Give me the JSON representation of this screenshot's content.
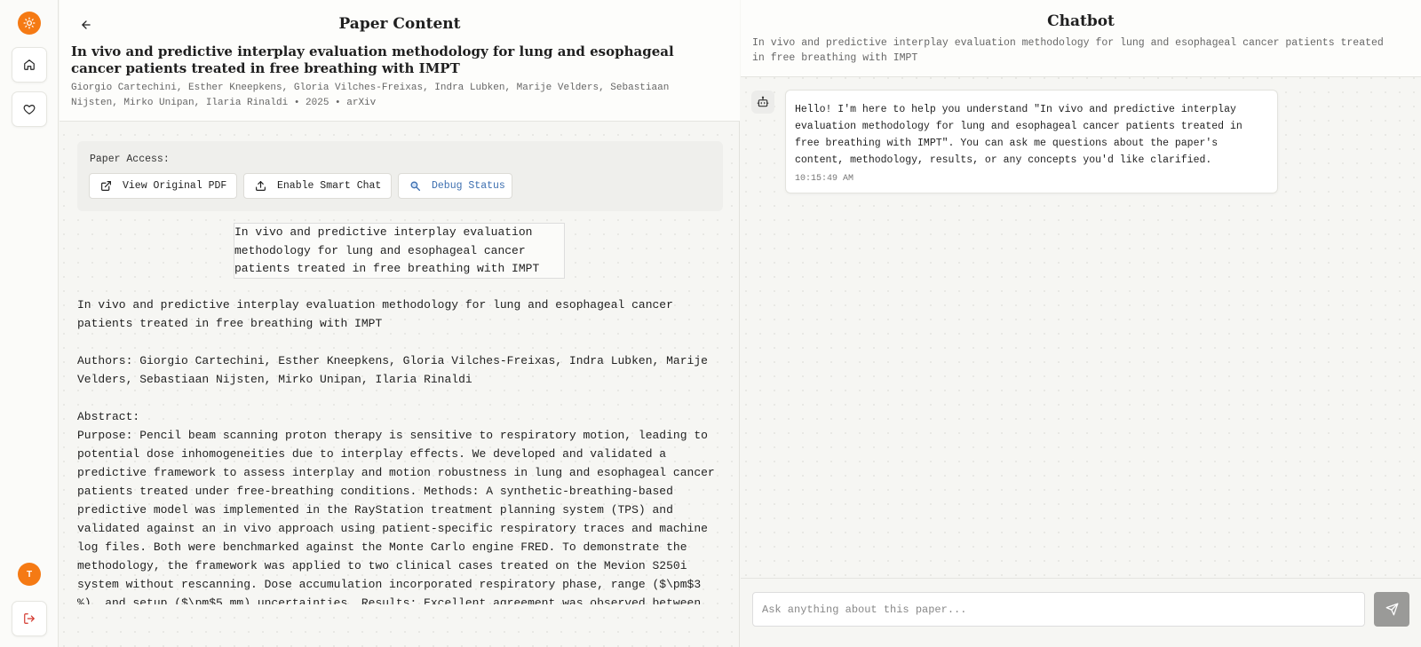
{
  "rail": {
    "icons": [
      "sun-icon",
      "home-icon",
      "heart-icon",
      "logout-icon"
    ],
    "avatar_initial": "T",
    "accent_color": "#f57a14"
  },
  "paper": {
    "header_title": "Paper Content",
    "title": "In vivo and predictive interplay evaluation methodology for lung and esophageal cancer patients treated in free breathing with IMPT",
    "meta": "Giorgio Cartechini, Esther Kneepkens, Gloria Vilches-Freixas, Indra Lubken, Marije Velders, Sebastiaan Nijsten, Mirko Unipan, Ilaria Rinaldi • 2025 • arXiv",
    "access": {
      "label": "Paper Access:",
      "view_pdf": "View Original PDF",
      "smart_chat": "Enable Smart Chat",
      "debug": "Debug Status"
    },
    "image_alt": "In vivo and predictive interplay evaluation methodology for lung and esophageal cancer patients treated in free breathing with IMPT",
    "body_title": "In vivo and predictive interplay evaluation methodology for lung and esophageal cancer patients treated in free breathing with IMPT",
    "authors_line": "Authors: Giorgio Cartechini, Esther Kneepkens, Gloria Vilches-Freixas, Indra Lubken, Marije Velders, Sebastiaan Nijsten, Mirko Unipan, Ilaria Rinaldi",
    "abstract_label": "Abstract:",
    "abstract_text": "Purpose: Pencil beam scanning proton therapy is sensitive to respiratory motion, leading to potential dose inhomogeneities due to interplay effects. We developed and validated a predictive framework to assess interplay and motion robustness in lung and esophageal cancer patients treated under free-breathing conditions. Methods: A synthetic-breathing-based predictive model was implemented in the RayStation treatment planning system (TPS) and validated against an in vivo approach using patient-specific respiratory traces and machine log files. Both were benchmarked against the Monte Carlo engine FRED. To demonstrate the methodology, the framework was applied to two clinical cases treated on the Mevion S250i system without rescanning. Dose accumulation incorporated respiratory phase, range ($\\pm$3 %), and setup ($\\pm$5 mm) uncertainties. Results: Excellent agreement was observed between"
  },
  "chat": {
    "title": "Chatbot",
    "subtitle": "In vivo and predictive interplay evaluation methodology for lung and esophageal cancer patients treated in free breathing with IMPT",
    "messages": [
      {
        "sender": "bot",
        "text": "Hello! I'm here to help you understand \"In vivo and predictive interplay evaluation methodology for lung and esophageal cancer patients treated in free breathing with IMPT\". You can ask me questions about the paper's content, methodology, results, or any concepts you'd like clarified.",
        "time": "10:15:49 AM"
      }
    ],
    "input_placeholder": "Ask anything about this paper..."
  }
}
